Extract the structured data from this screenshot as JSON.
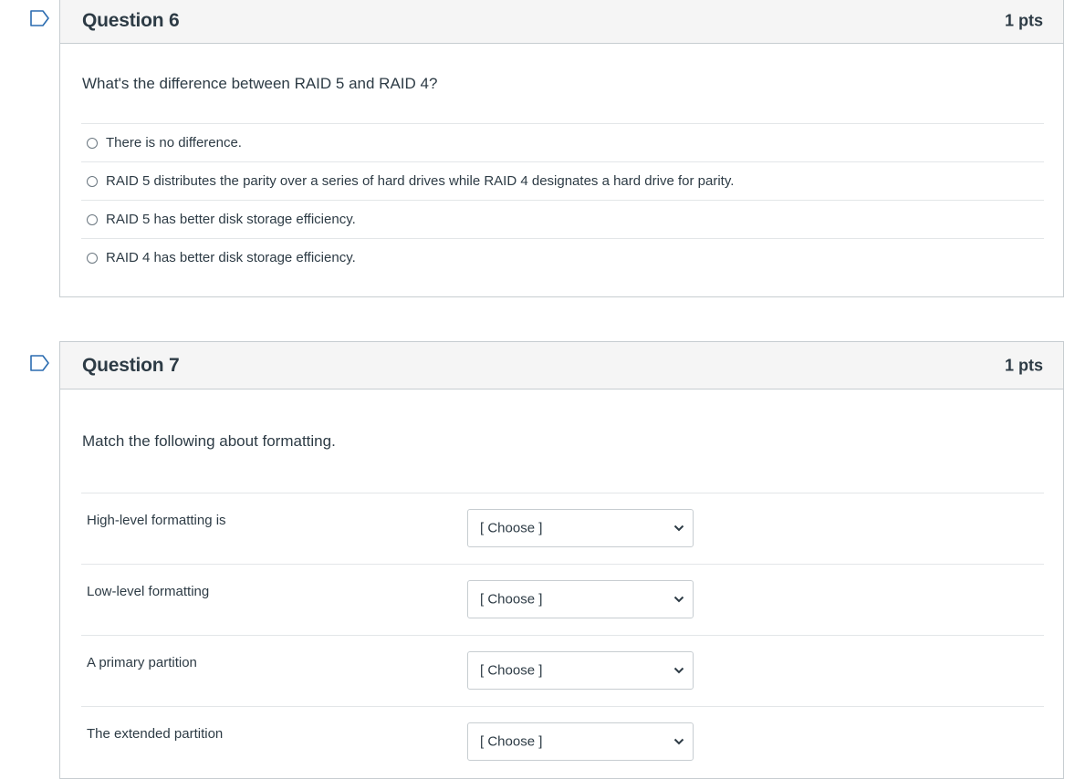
{
  "questions": [
    {
      "title": "Question 6",
      "points": "1 pts",
      "prompt": "What's the difference between RAID 5 and RAID 4?",
      "answers": [
        "There is no difference.",
        "RAID 5 distributes the parity over a series of hard drives while RAID 4 designates a hard drive for parity.",
        "RAID 5 has better disk storage efficiency.",
        "RAID 4 has better disk storage efficiency."
      ]
    },
    {
      "title": "Question 7",
      "points": "1 pts",
      "prompt": "Match the following about formatting.",
      "matches": [
        {
          "label": "High-level formatting is",
          "selected": "[ Choose ]"
        },
        {
          "label": "Low-level formatting",
          "selected": "[ Choose ]"
        },
        {
          "label": "A primary partition",
          "selected": "[ Choose ]"
        },
        {
          "label": "The extended partition",
          "selected": "[ Choose ]"
        }
      ]
    }
  ],
  "icons": {
    "flag": "flag-icon",
    "dropdown": "chevron-down-icon"
  },
  "colors": {
    "flag_stroke": "#2b6cb0",
    "header_bg": "#f5f5f5",
    "border": "#c7cdd1",
    "text": "#2d3b45"
  }
}
